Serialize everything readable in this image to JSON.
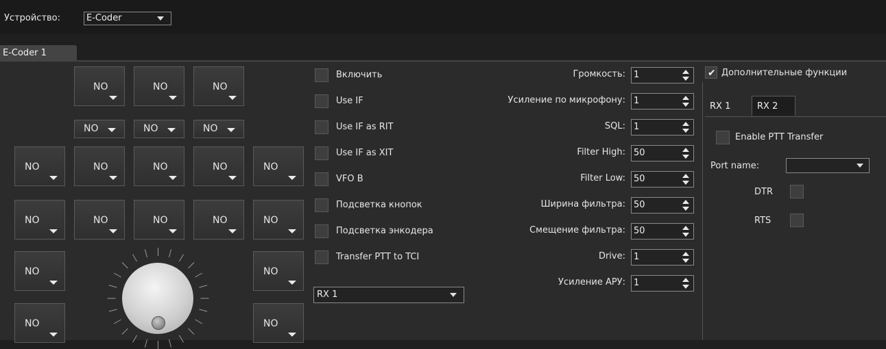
{
  "device": {
    "label": "Устройство:",
    "selected": "E-Coder"
  },
  "device_tab": "E-Coder 1",
  "button_label": "NO",
  "checkboxes": [
    {
      "label": "Включить",
      "checked": false
    },
    {
      "label": "Use IF",
      "checked": false
    },
    {
      "label": "Use IF as RIT",
      "checked": false
    },
    {
      "label": "Use IF as XIT",
      "checked": false
    },
    {
      "label": "VFO B",
      "checked": false
    },
    {
      "label": "Подсветка кнопок",
      "checked": false
    },
    {
      "label": "Подсветка энкодера",
      "checked": false
    },
    {
      "label": "Transfer PTT to TCI",
      "checked": false
    }
  ],
  "rx_select": "RX 1",
  "params": [
    {
      "label": "Громкость:",
      "value": "1"
    },
    {
      "label": "Усиление по микрофону:",
      "value": "1"
    },
    {
      "label": "SQL:",
      "value": "1"
    },
    {
      "label": "Filter High:",
      "value": "50"
    },
    {
      "label": "Filter Low:",
      "value": "50"
    },
    {
      "label": "Ширина фильтра:",
      "value": "50"
    },
    {
      "label": "Смещение фильтра:",
      "value": "50"
    },
    {
      "label": "Drive:",
      "value": "1"
    },
    {
      "label": "Усиление АРУ:",
      "value": "1"
    }
  ],
  "extra": {
    "label": "Дополнительные функции",
    "checked": true,
    "tabs": [
      "RX 1",
      "RX 2"
    ],
    "enable_ptt": "Enable PTT Transfer",
    "port_label": "Port name:",
    "port_value": "",
    "dtr": "DTR",
    "rts": "RTS"
  }
}
